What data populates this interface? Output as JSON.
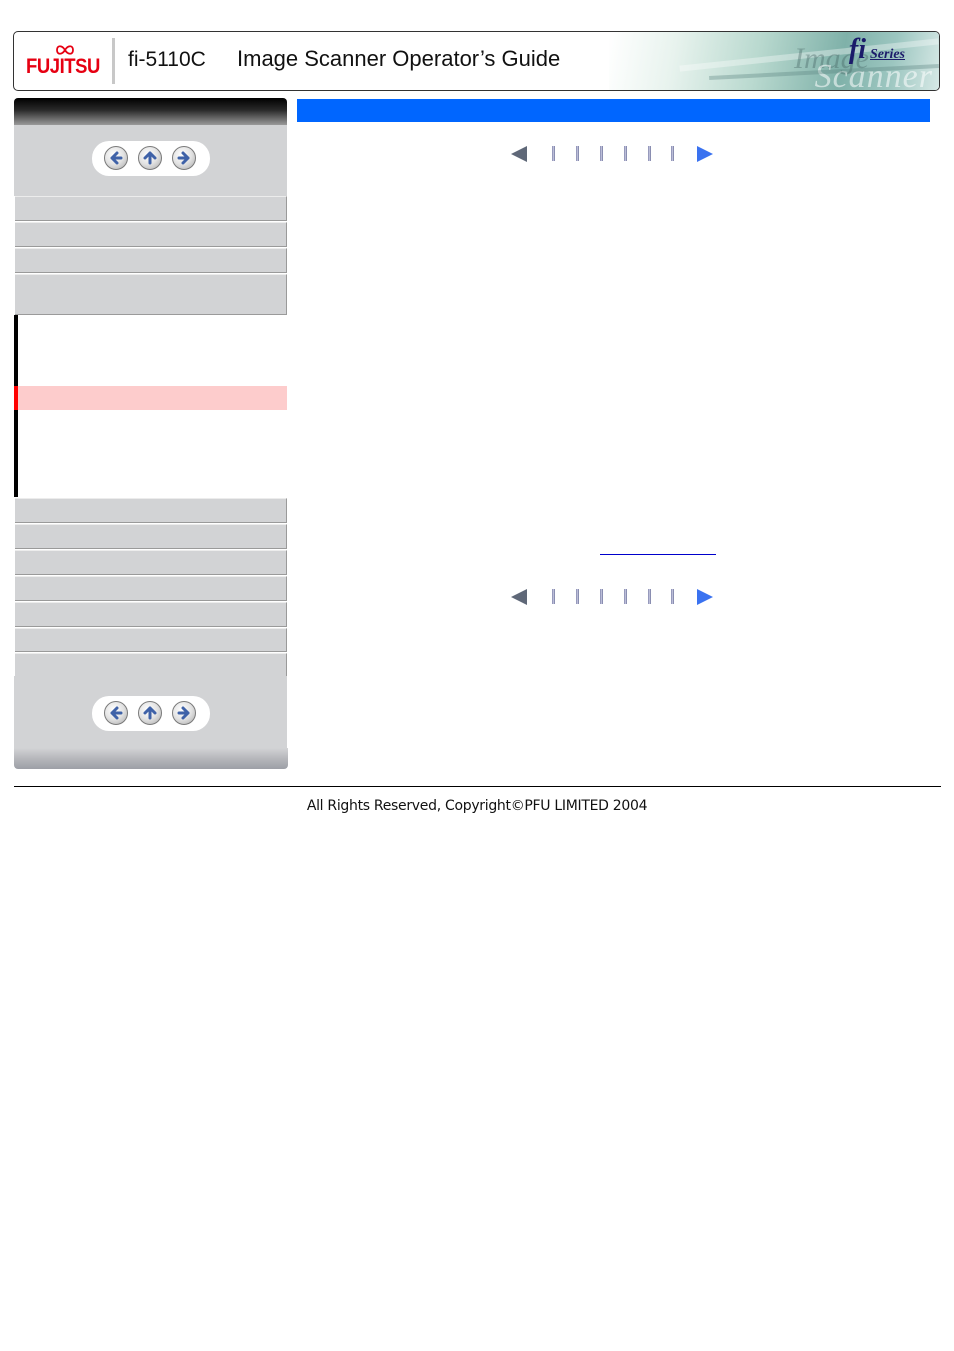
{
  "header": {
    "brand": "FUJITSU",
    "model": "fi-5110C",
    "title": "Image Scanner Operator’s Guide",
    "banner": {
      "logo_fi": "fi",
      "logo_series": "Series",
      "watermark_1": "Image",
      "watermark_2": "Scanner"
    }
  },
  "sidebar": {
    "top_nav": [
      {
        "icon": "arrow-left-icon",
        "action": "previous"
      },
      {
        "icon": "arrow-up-icon",
        "action": "up"
      },
      {
        "icon": "arrow-right-icon",
        "action": "next"
      }
    ],
    "menu_items_top_count": 4,
    "sub_items_active_index": 2,
    "menu_items_bottom_count": 7,
    "bottom_nav": [
      {
        "icon": "arrow-left-icon",
        "action": "previous"
      },
      {
        "icon": "arrow-up-icon",
        "action": "up"
      },
      {
        "icon": "arrow-right-icon",
        "action": "next"
      }
    ]
  },
  "main": {
    "title": "",
    "pager": {
      "prev_icon": "triangle-left-icon",
      "next_icon": "triangle-right-icon",
      "page_ticks": 6
    },
    "link_text": ""
  },
  "colors": {
    "title_bar": "#0066ff",
    "active_item_bg": "#fdcccc",
    "active_marker": "#ff0000",
    "sidebar_bg": "#d2d3d5",
    "brand_red": "#e60012"
  },
  "footer": {
    "copyright": "All Rights Reserved,  Copyright©PFU LIMITED 2004"
  }
}
